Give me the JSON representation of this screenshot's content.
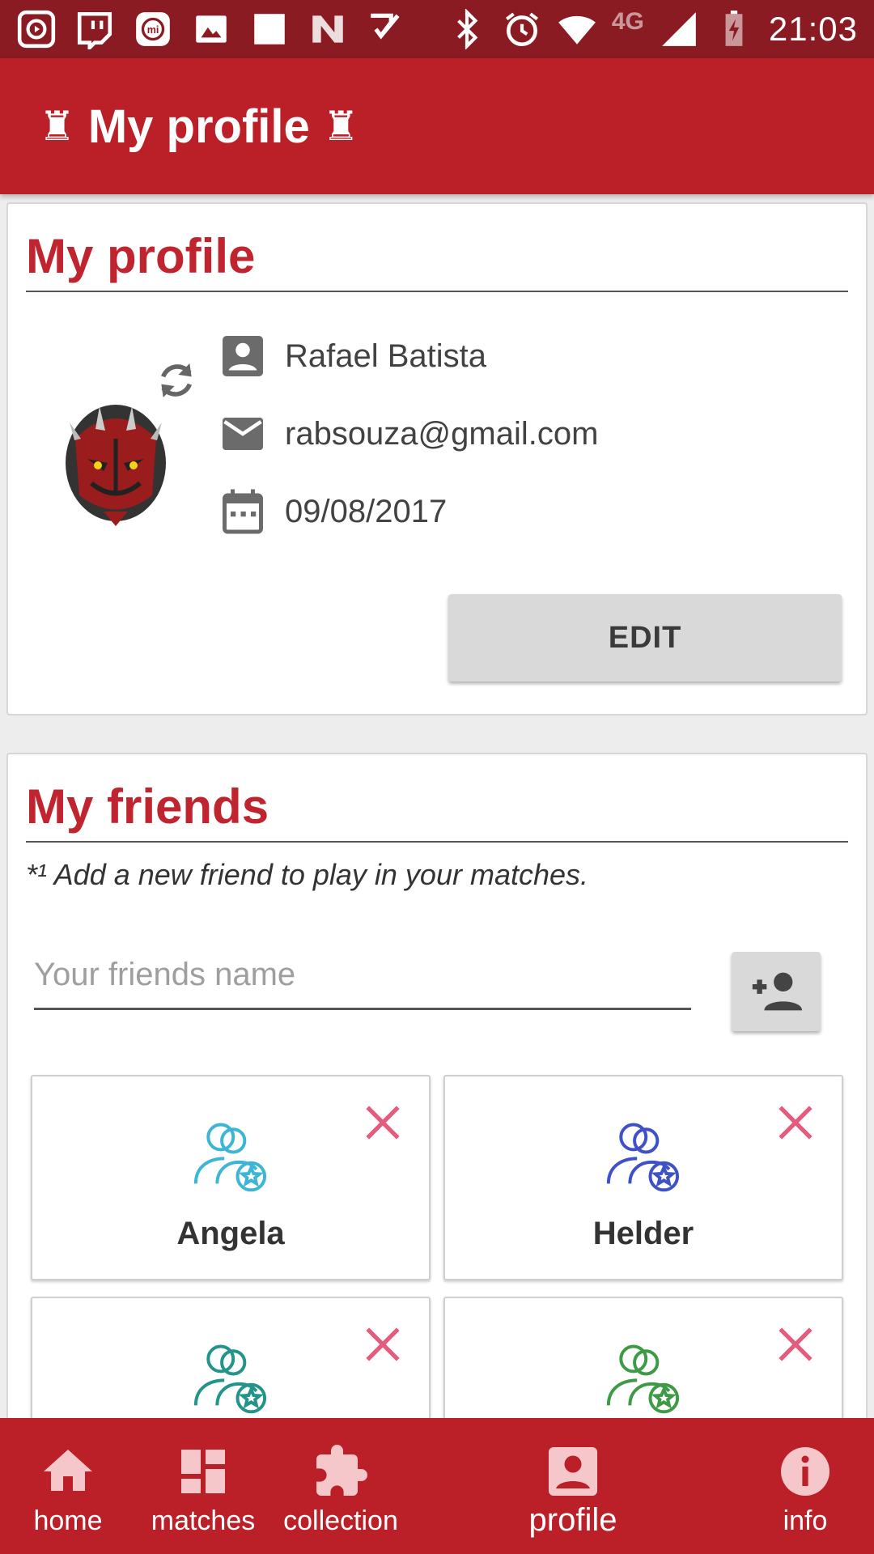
{
  "status_bar": {
    "network": "4G",
    "time": "21:03",
    "icons": [
      "media-icon",
      "twitch-icon",
      "mi-icon",
      "image-icon",
      "square-icon",
      "n-icon",
      "check-icon",
      "bluetooth-icon",
      "alarm-icon",
      "wifi-icon",
      "signal-icon",
      "battery-icon"
    ]
  },
  "app_bar": {
    "title": "My profile",
    "decoration_icon": "rook-icon",
    "color": "#bb1f28"
  },
  "profile": {
    "section_title": "My profile",
    "name": "Rafael Batista",
    "email": "rabsouza@gmail.com",
    "date": "09/08/2017",
    "edit_label": "EDIT",
    "avatar_icon": "darth-maul-avatar",
    "change_avatar_icon": "refresh-icon"
  },
  "friends": {
    "section_title": "My friends",
    "hint": "*¹ Add a new friend to play in your matches.",
    "input_placeholder": "Your friends name",
    "add_button_icon": "add-person-icon",
    "list": [
      {
        "name": "Angela",
        "icon_color": "#3cb6d4"
      },
      {
        "name": "Helder",
        "icon_color": "#3f51c6"
      },
      {
        "name": "",
        "icon_color": "#23948a"
      },
      {
        "name": "",
        "icon_color": "#3e9a45"
      }
    ],
    "remove_color": "#e65a7d"
  },
  "bottom_nav": {
    "items": [
      {
        "label": "home",
        "icon": "home-icon"
      },
      {
        "label": "matches",
        "icon": "dashboard-icon"
      },
      {
        "label": "collection",
        "icon": "puzzle-icon"
      },
      {
        "label": "profile",
        "icon": "profile-badge-icon",
        "active": true
      },
      {
        "label": "info",
        "icon": "info-icon"
      }
    ]
  },
  "colors": {
    "accent": "#c0252f",
    "status_bar": "#8a1b22",
    "nav_inactive_icon": "#f5c6ca"
  }
}
